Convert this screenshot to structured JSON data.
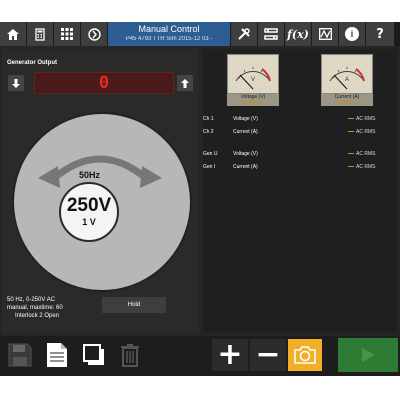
{
  "header": {
    "title": "Manual Control",
    "subtitle": "P45 4793 TTR Sim 2015-12 03 -"
  },
  "toolbar": {
    "buttons": [
      {
        "name": "home-icon"
      },
      {
        "name": "calculator-icon"
      },
      {
        "name": "grid-icon"
      },
      {
        "name": "power-icon"
      },
      {
        "name": "tools-icon"
      },
      {
        "name": "settings-list-icon"
      },
      {
        "name": "function-icon",
        "label": "f(x)"
      },
      {
        "name": "waveform-icon"
      },
      {
        "name": "info-icon",
        "label": "i"
      },
      {
        "name": "help-icon",
        "label": "?"
      }
    ]
  },
  "generator": {
    "title": "Generator Output",
    "display_value": "0",
    "frequency": "50Hz",
    "voltage": "250V",
    "voltage_setting": "1 V",
    "info_line1": "50 Hz, 0-250V AC",
    "info_line2": "manual, maxtime: 60",
    "info_line3": "Interlock 2 Open",
    "hold_label": "Hold"
  },
  "meters": [
    {
      "label": "Voltage (V)",
      "value": "0.0000 V",
      "unit": "V"
    },
    {
      "label": "Current (A)",
      "value": "0.0000 A",
      "unit": "A"
    }
  ],
  "channels": [
    {
      "ch": "Ch 1",
      "quantity": "Voltage (V)",
      "mode": "AC RMS"
    },
    {
      "ch": "Ch 2",
      "quantity": "Current (A)",
      "mode": "AC RMS"
    },
    {
      "ch": "Gen U",
      "quantity": "Voltage (V)",
      "mode": "AC RMS"
    },
    {
      "ch": "Gen I",
      "quantity": "Current (A)",
      "mode": "AC RMS"
    }
  ],
  "colors": {
    "title_bar": "#2d5d92",
    "seven_segment": "#e52a2a",
    "camera_button": "#f2ae27",
    "play_button": "#2e7c34",
    "meter_value": "#c98a17"
  }
}
